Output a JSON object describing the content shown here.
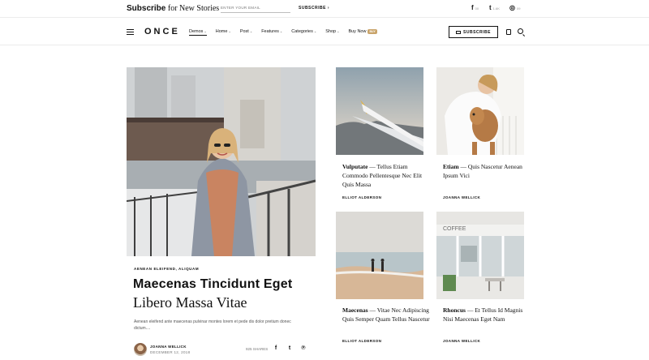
{
  "topbar": {
    "subscribe_strong": "Subscribe",
    "subscribe_rest": " for New Stories",
    "email_placeholder": "ENTER YOUR EMAIL",
    "subscribe_button": "SUBSCRIBE",
    "social": [
      {
        "icon": "facebook-icon",
        "glyph": "f",
        "count": "00"
      },
      {
        "icon": "twitter-icon",
        "glyph": "t",
        "count": "1.6K"
      },
      {
        "icon": "instagram-icon",
        "glyph": "◎",
        "count": "09"
      }
    ]
  },
  "header": {
    "logo": "ONCE",
    "nav": [
      {
        "label": "Demos",
        "caret": true,
        "active": true
      },
      {
        "label": "Home",
        "caret": true
      },
      {
        "label": "Post",
        "caret": true
      },
      {
        "label": "Features",
        "caret": true
      },
      {
        "label": "Categories",
        "caret": true
      },
      {
        "label": "Shop",
        "caret": true
      },
      {
        "label": "Buy Now",
        "badge": "BUY"
      }
    ],
    "subscribe_button": "SUBSCRIBE"
  },
  "featured": {
    "categories": "AENEAN ELEIFEND, ALIQUAM",
    "title_line1": "Maecenas Tincidunt Eget",
    "title_line2": "Libero Massa Vitae",
    "excerpt": "Aenean eleifend ante maecenas pulvinar montes lorem et pede dis dolor pretium donec dictum....",
    "author": "JOANNA WELLICK",
    "date": "DECEMBER 12, 2018",
    "shares": "925 SHARES"
  },
  "cards": [
    {
      "strong": "Vulputate",
      "rest": "Tellus Etiam Commodo Pellentesque Nec Elit Quis Massa",
      "author": "ELLIOT ALDERSON"
    },
    {
      "strong": "Etiam",
      "rest": "Quis Nascetur Aenean Ipsum Vici",
      "author": "JOANNA WELLICK"
    },
    {
      "strong": "Maecenas",
      "rest": "Vitae Nec Adipiscing Quis Semper Quam Tellus Nascetur",
      "author": "ELLIOT ALDERSON"
    },
    {
      "strong": "Rhoncus",
      "rest": "Et Tellus Id Magnis Nisi Maecenas Eget Nam",
      "author": "JOANNA WELLICK"
    }
  ],
  "images": {
    "coffee_sign": "COFFEE"
  },
  "colors": {
    "accent": "#c9a46a",
    "text": "#111111"
  }
}
